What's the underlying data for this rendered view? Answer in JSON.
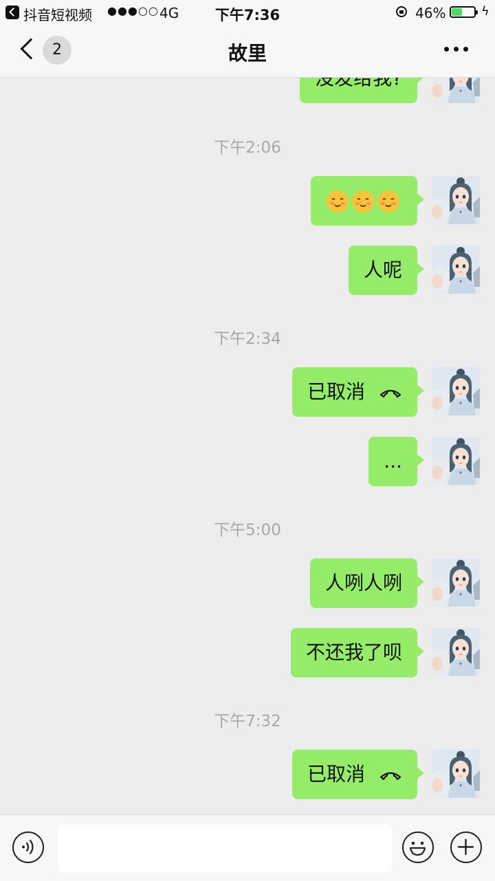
{
  "status_bar": {
    "app_name": "抖音短视频",
    "signal": "●●●○○",
    "network": "4G",
    "time": "下午7:36",
    "battery_percent": "46%",
    "battery_level": 0.46
  },
  "nav": {
    "unread_count": "2",
    "title": "故里"
  },
  "messages": {
    "m0": {
      "text": "没发给我?"
    },
    "t1": "下午2:06",
    "m1": {
      "emoji": [
        "smiling-face",
        "smiling-face",
        "smiling-face"
      ]
    },
    "m2": {
      "text": "人呢"
    },
    "t2": "下午2:34",
    "m3": {
      "text": "已取消",
      "icon": "phone-hangup-icon"
    },
    "m4": {
      "text": "..."
    },
    "t3": "下午5:00",
    "m5": {
      "text": "人咧人咧"
    },
    "m6": {
      "text": "不还我了呗"
    },
    "t4": "下午7:32",
    "m7": {
      "text": "已取消",
      "icon": "phone-hangup-icon"
    }
  },
  "colors": {
    "bubble_self": "#95ec69",
    "background": "#ededed",
    "timestamp": "#a7a7a7"
  }
}
